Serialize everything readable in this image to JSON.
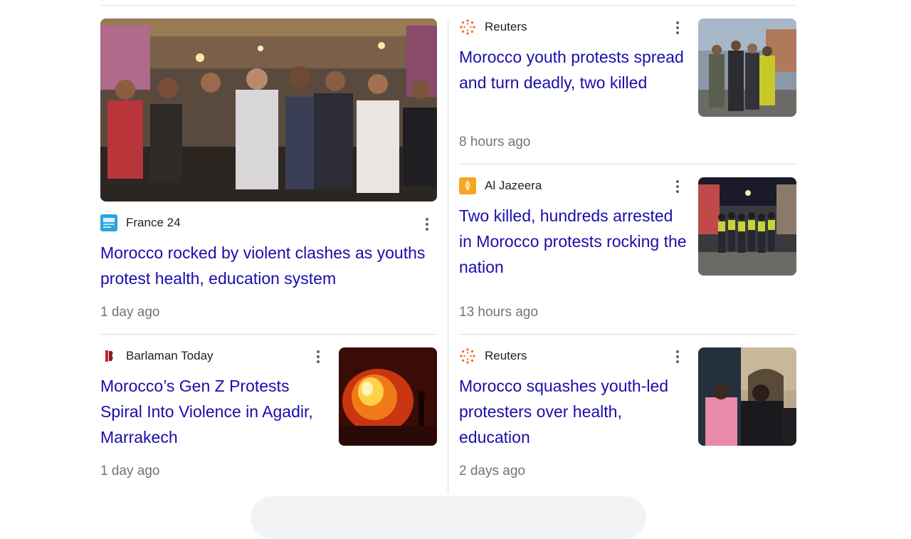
{
  "colors": {
    "headline": "#1a0dab",
    "timestamp": "#70757a",
    "divider": "#dadce0",
    "source_text": "#202124"
  },
  "articles": [
    {
      "source": "France 24",
      "favicon": "france24-icon",
      "headline": "Morocco rocked by violent clashes as youths protest health, education system",
      "time": "1 day ago",
      "image": "crowd-protest-image"
    },
    {
      "source": "Reuters",
      "favicon": "reuters-icon",
      "headline": "Morocco youth protests spread and turn deadly, two killed",
      "time": "8 hours ago",
      "image": "police-escort-image"
    },
    {
      "source": "Al Jazeera",
      "favicon": "aljazeera-icon",
      "headline": "Two killed, hundreds arrested in Morocco protests rocking the nation",
      "time": "13 hours ago",
      "image": "police-line-image"
    },
    {
      "source": "Barlaman Today",
      "favicon": "barlaman-icon",
      "headline": "Morocco’s Gen Z Protests Spiral Into Violence in Agadir, Marrakech",
      "time": "1 day ago",
      "image": "fire-night-image"
    },
    {
      "source": "Reuters",
      "favicon": "reuters-icon",
      "headline": "Morocco squashes youth-led protesters over health, education",
      "time": "2 days ago",
      "image": "arrest-street-image"
    }
  ]
}
